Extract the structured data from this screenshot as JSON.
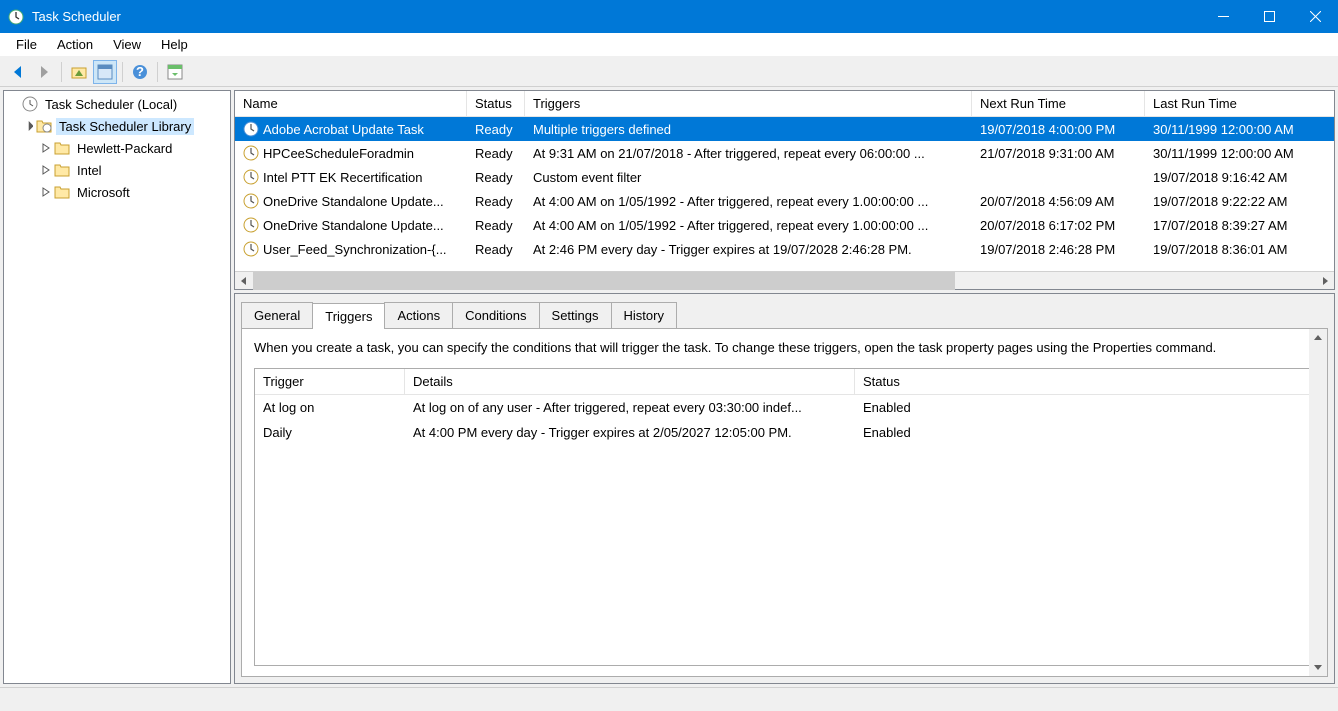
{
  "window": {
    "title": "Task Scheduler"
  },
  "menu": {
    "file": "File",
    "action": "Action",
    "view": "View",
    "help": "Help"
  },
  "tree": {
    "root": "Task Scheduler (Local)",
    "library": "Task Scheduler Library",
    "nodes": {
      "hp": "Hewlett-Packard",
      "intel": "Intel",
      "microsoft": "Microsoft"
    }
  },
  "list": {
    "headers": {
      "name": "Name",
      "status": "Status",
      "triggers": "Triggers",
      "next": "Next Run Time",
      "last": "Last Run Time"
    },
    "rows": [
      {
        "name": "Adobe Acrobat Update Task",
        "status": "Ready",
        "triggers": "Multiple triggers defined",
        "next": "19/07/2018 4:00:00 PM",
        "last": "30/11/1999 12:00:00 AM"
      },
      {
        "name": "HPCeeScheduleForadmin",
        "status": "Ready",
        "triggers": "At 9:31 AM on 21/07/2018 - After triggered, repeat every 06:00:00 ...",
        "next": "21/07/2018 9:31:00 AM",
        "last": "30/11/1999 12:00:00 AM"
      },
      {
        "name": "Intel PTT EK Recertification",
        "status": "Ready",
        "triggers": "Custom event filter",
        "next": "",
        "last": "19/07/2018 9:16:42 AM"
      },
      {
        "name": "OneDrive Standalone Update...",
        "status": "Ready",
        "triggers": "At 4:00 AM on 1/05/1992 - After triggered, repeat every 1.00:00:00 ...",
        "next": "20/07/2018 4:56:09 AM",
        "last": "19/07/2018 9:22:22 AM"
      },
      {
        "name": "OneDrive Standalone Update...",
        "status": "Ready",
        "triggers": "At 4:00 AM on 1/05/1992 - After triggered, repeat every 1.00:00:00 ...",
        "next": "20/07/2018 6:17:02 PM",
        "last": "17/07/2018 8:39:27 AM"
      },
      {
        "name": "User_Feed_Synchronization-{...",
        "status": "Ready",
        "triggers": "At 2:46 PM every day - Trigger expires at 19/07/2028 2:46:28 PM.",
        "next": "19/07/2018 2:46:28 PM",
        "last": "19/07/2018 8:36:01 AM"
      }
    ]
  },
  "tabs": {
    "general": "General",
    "triggers": "Triggers",
    "actions": "Actions",
    "conditions": "Conditions",
    "settings": "Settings",
    "history": "History"
  },
  "triggers_tab": {
    "description": "When you create a task, you can specify the conditions that will trigger the task.  To change these triggers, open the task property pages using the Properties command.",
    "headers": {
      "trigger": "Trigger",
      "details": "Details",
      "status": "Status"
    },
    "rows": [
      {
        "trigger": "At log on",
        "details": "At log on of any user - After triggered, repeat every 03:30:00 indef...",
        "status": "Enabled"
      },
      {
        "trigger": "Daily",
        "details": "At 4:00 PM every day - Trigger expires at 2/05/2027 12:05:00 PM.",
        "status": "Enabled"
      }
    ]
  }
}
